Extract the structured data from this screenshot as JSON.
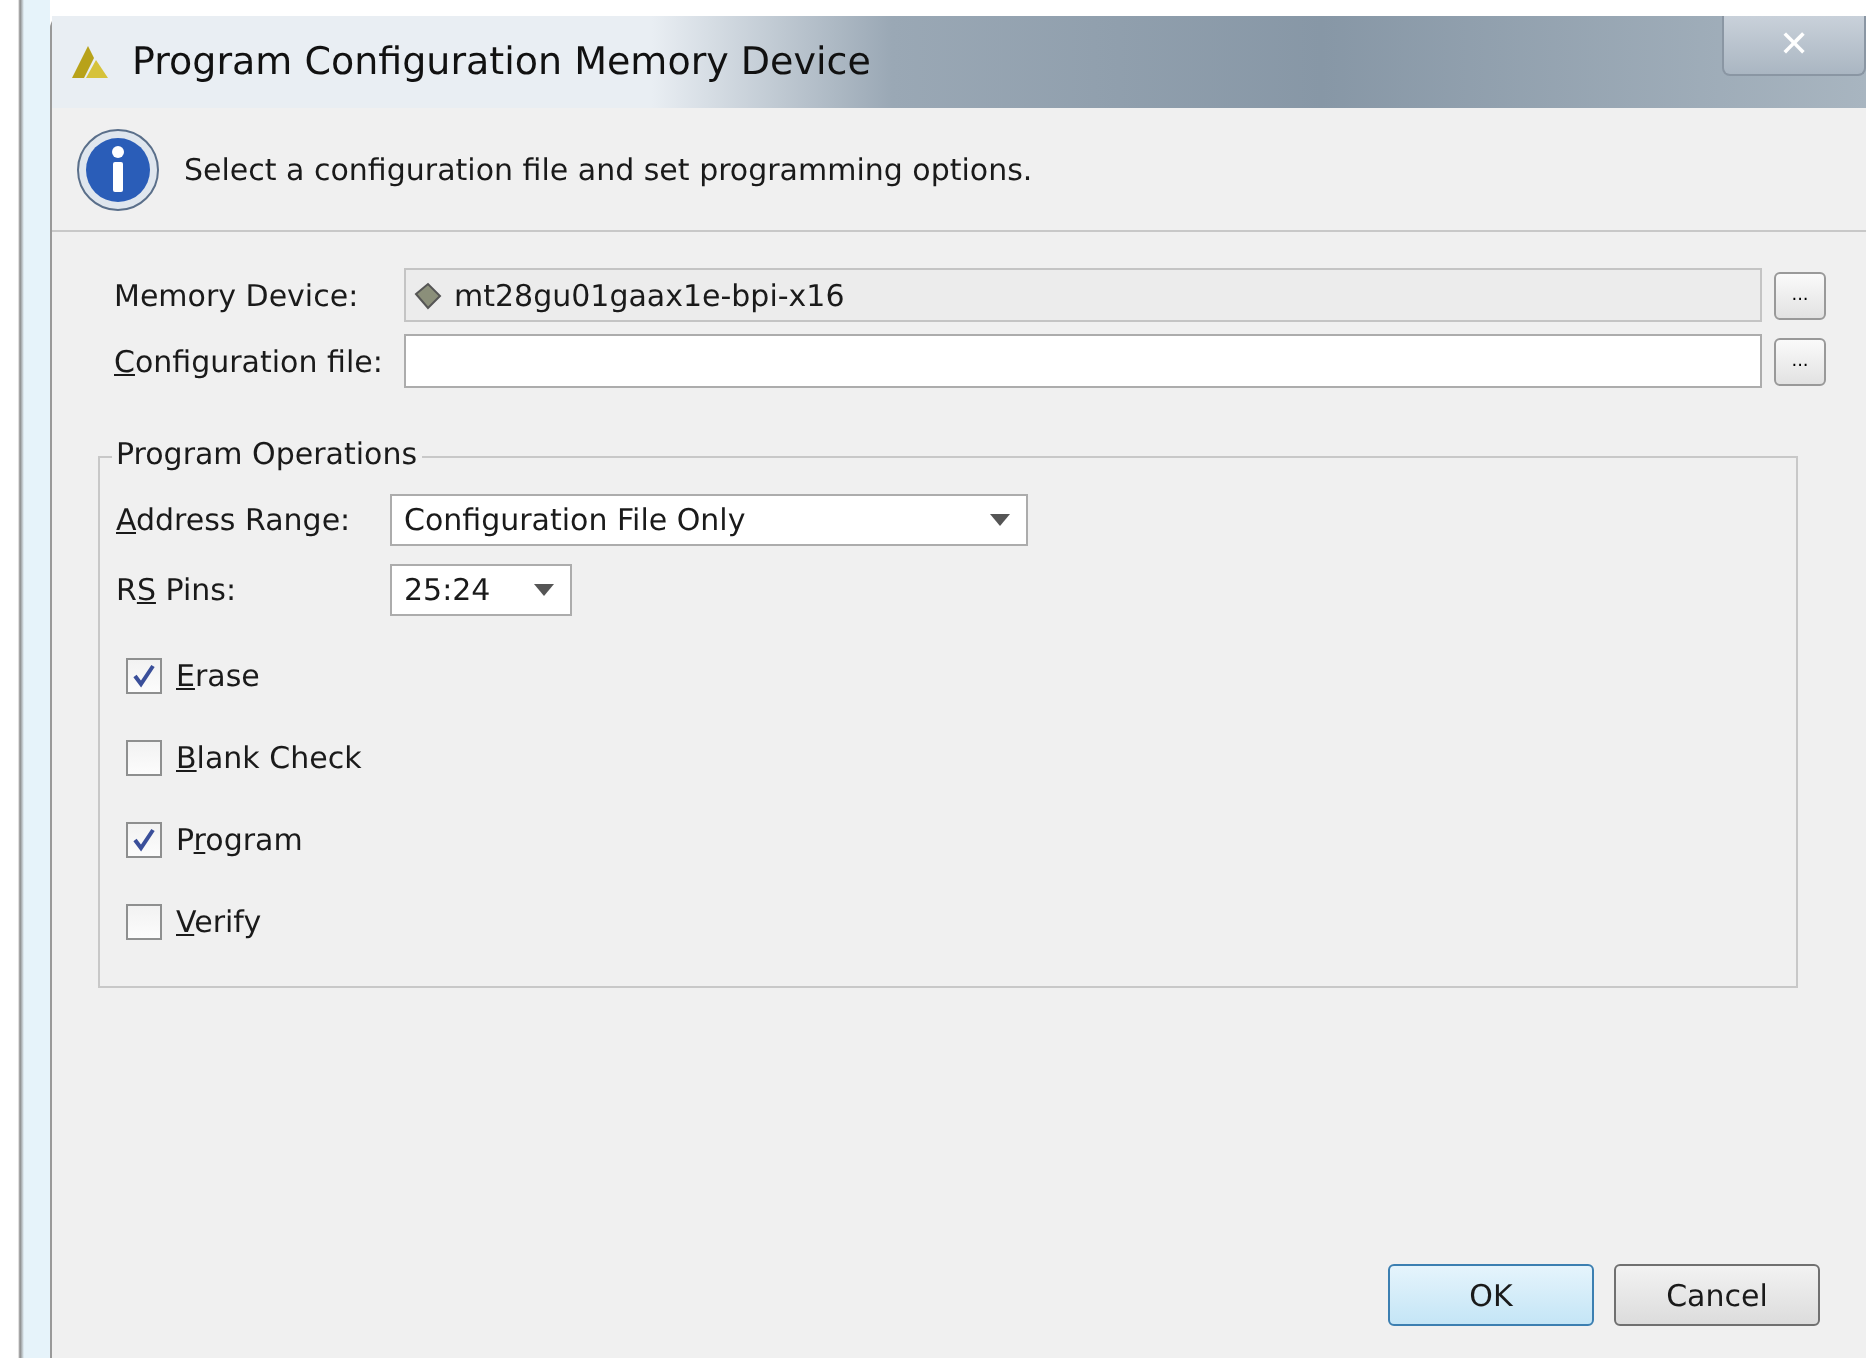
{
  "window": {
    "title": "Program Configuration Memory Device",
    "close_glyph": "✕"
  },
  "header": {
    "message": "Select a configuration file and set programming options."
  },
  "fields": [
    {
      "label": {
        "rest": "Memory Device:"
      },
      "value": "mt28gu01gaax1e-bpi-x16",
      "editable": false,
      "browse": "..."
    },
    {
      "label": {
        "key": "C",
        "rest": "onfiguration file:"
      },
      "editable": true,
      "browse": "..."
    }
  ],
  "group": {
    "title": "Program Operations",
    "dropdowns": [
      {
        "label": {
          "key": "A",
          "rest": "ddress Range:"
        },
        "value": "Configuration File Only"
      },
      {
        "label": {
          "before": "R",
          "key": "S",
          "rest": " Pins:"
        },
        "value": "25:24"
      }
    ],
    "checkboxes": [
      {
        "label": {
          "key": "E",
          "rest": "rase"
        },
        "checked": true
      },
      {
        "label": {
          "key": "B",
          "rest": "lank Check"
        },
        "checked": false
      },
      {
        "label": {
          "before": "P",
          "key": "r",
          "rest": "ogram"
        },
        "checked": true
      },
      {
        "label": {
          "key": "V",
          "rest": "erify"
        },
        "checked": false
      }
    ]
  },
  "buttons": [
    {
      "label": "OK",
      "default": true
    },
    {
      "label": "Cancel",
      "default": false
    }
  ]
}
